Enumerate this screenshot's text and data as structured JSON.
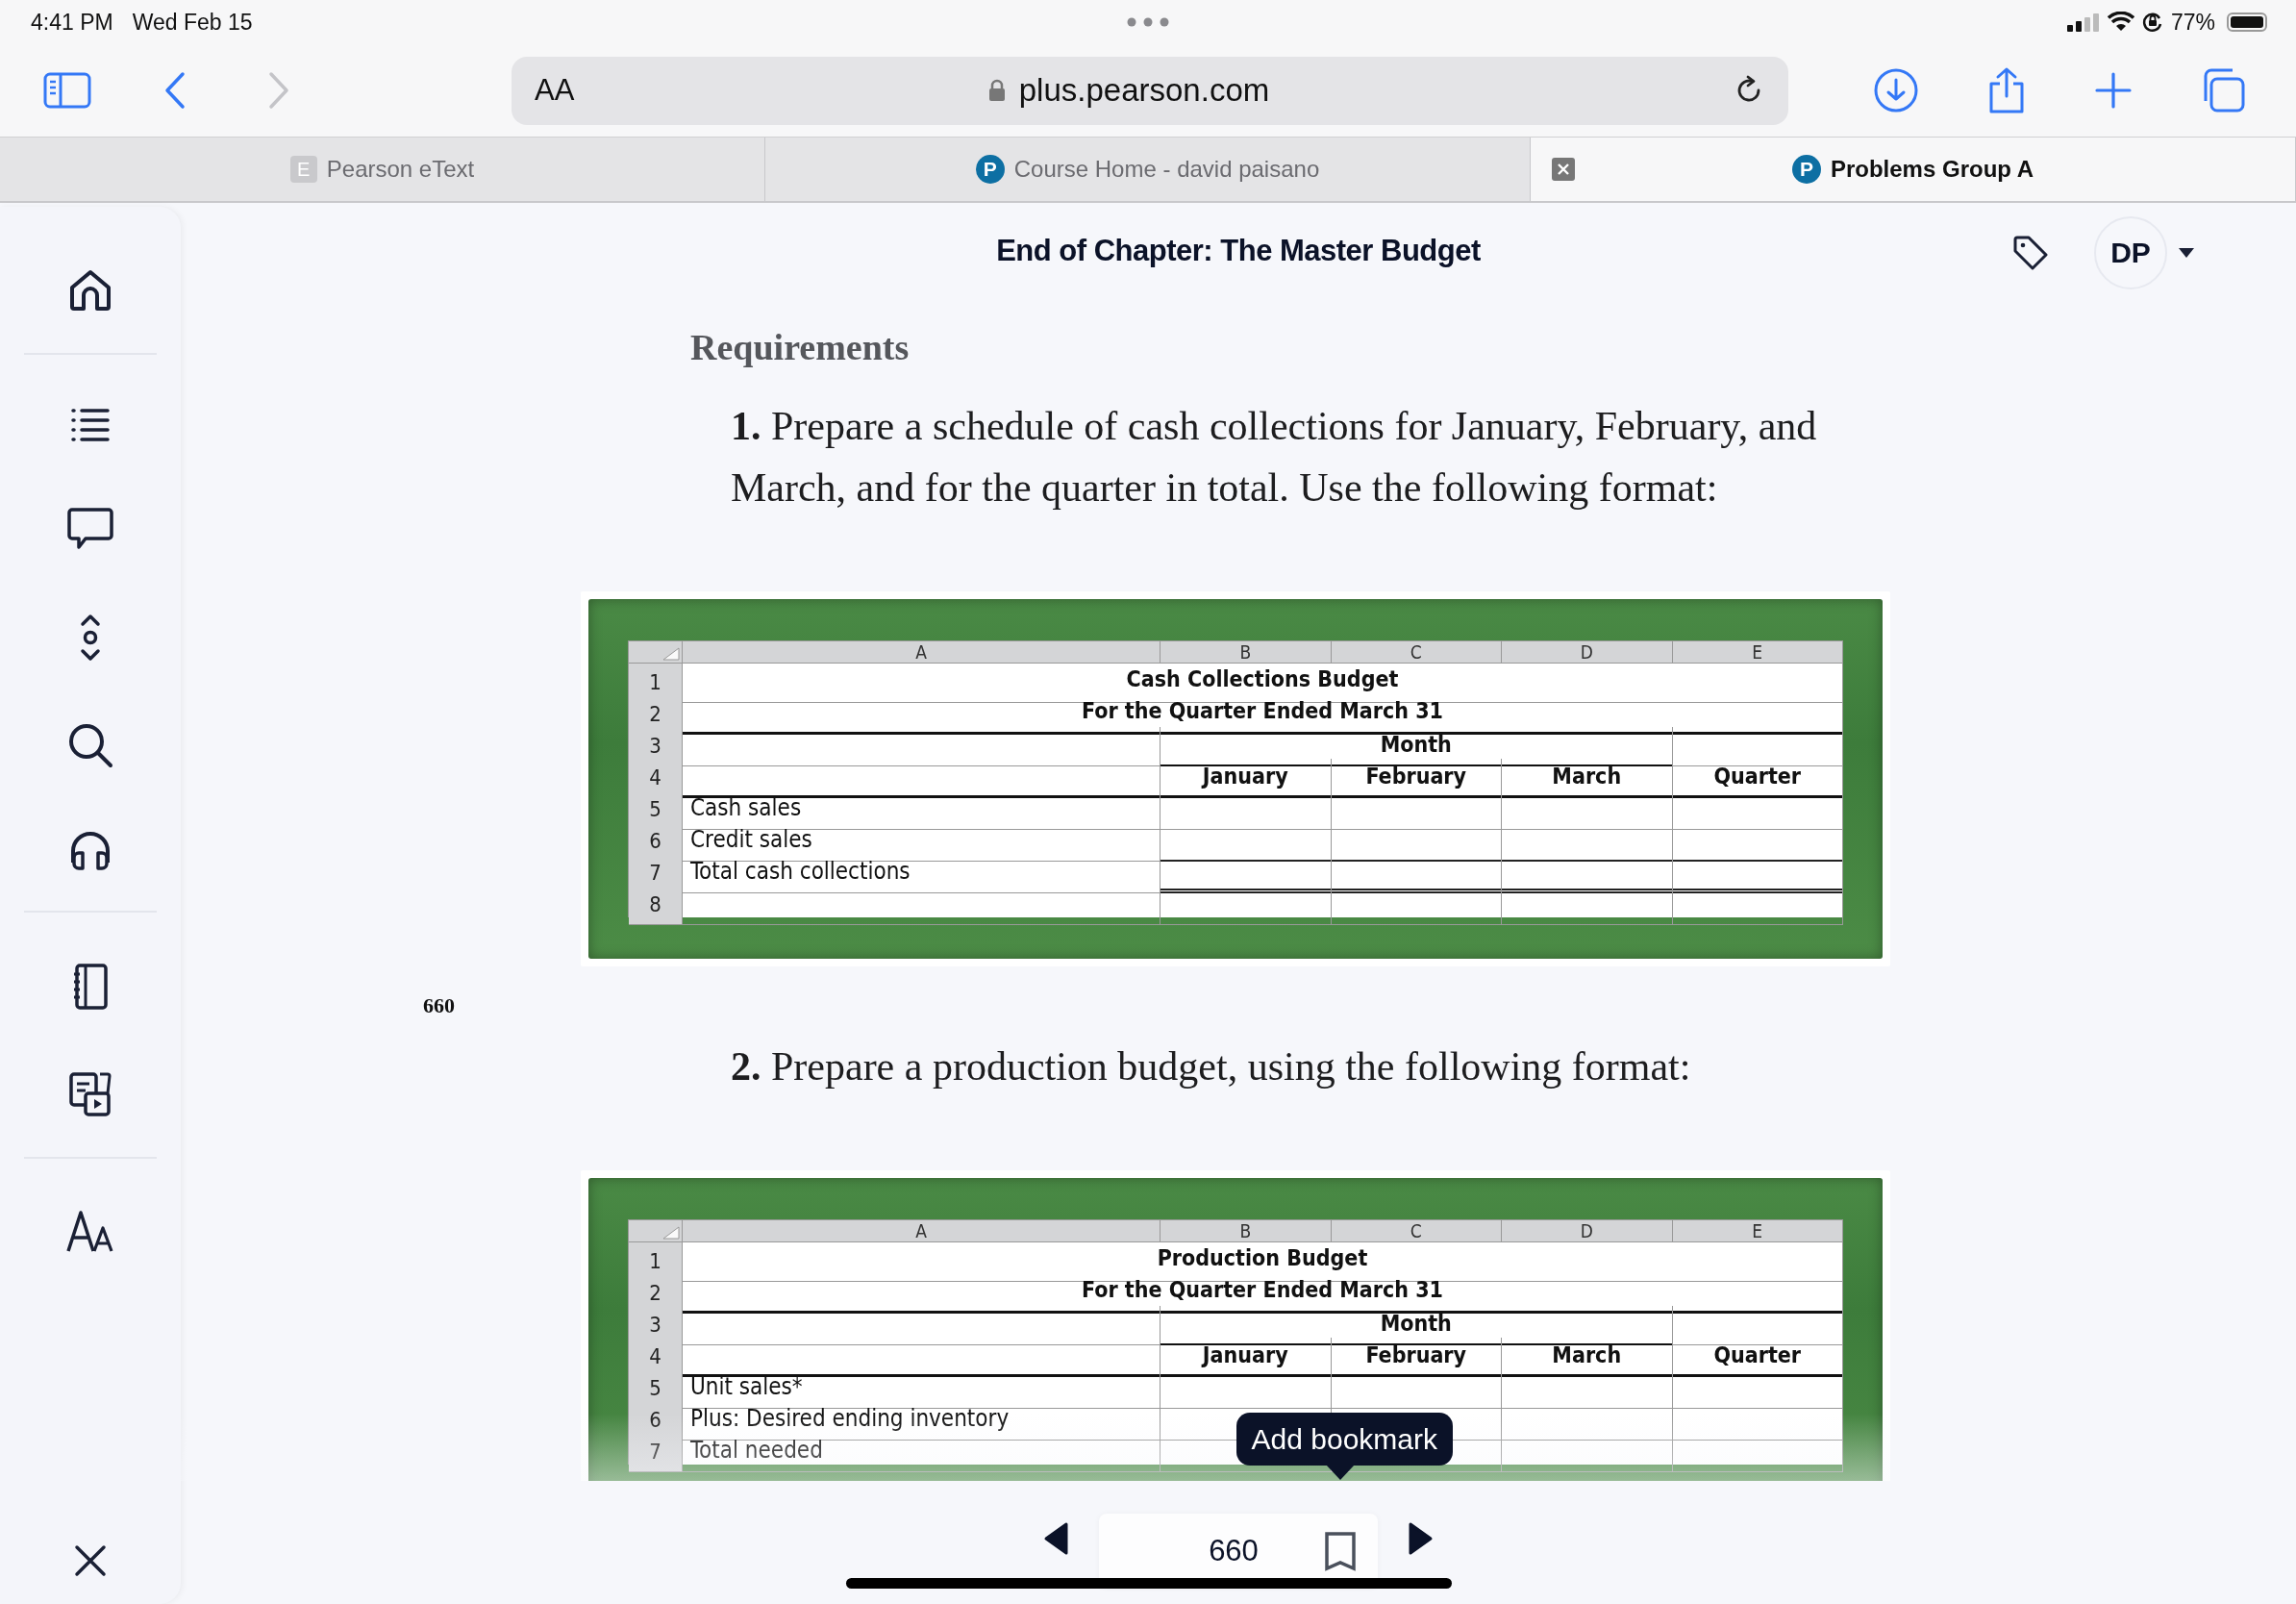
{
  "status_bar": {
    "time": "4:41 PM",
    "date": "Wed Feb 15",
    "battery": "77%"
  },
  "browser": {
    "text_size": "AA",
    "url": "plus.pearson.com",
    "back_enabled": true,
    "forward_enabled": false
  },
  "tabs": [
    {
      "label": "Pearson eText",
      "badge": "E",
      "kind": "letter-square",
      "selected": false,
      "closable": false
    },
    {
      "label": "Course Home - david paisano",
      "badge": "P",
      "kind": "logo",
      "selected": false,
      "closable": false
    },
    {
      "label": "Problems Group A",
      "badge": "P",
      "kind": "logo",
      "selected": true,
      "closable": true
    }
  ],
  "header": {
    "title": "End of Chapter: The Master Budget",
    "avatar": "DP"
  },
  "section_title": "Requirements",
  "page_label": "660",
  "requirements": [
    {
      "number": "1.",
      "text": "Prepare a schedule of cash collections for January, February, and March, and for the quarter in total. Use the following format:",
      "sheet": {
        "columns": [
          "A",
          "B",
          "C",
          "D",
          "E"
        ],
        "title": "Cash Collections Budget",
        "subtitle": "For the Quarter Ended March 31",
        "group_header": "Month",
        "periods": [
          "January",
          "February",
          "March",
          "Quarter"
        ],
        "row_numbers": [
          "1",
          "2",
          "3",
          "4",
          "5",
          "6",
          "7",
          "8"
        ],
        "line_items": [
          {
            "label": "Cash sales",
            "kind": "plain"
          },
          {
            "label": "Credit sales",
            "kind": "subtotal"
          },
          {
            "label": "Total cash collections",
            "kind": "total"
          }
        ]
      }
    },
    {
      "number": "2.",
      "text": "Prepare a production budget, using the following format:",
      "sheet": {
        "columns": [
          "A",
          "B",
          "C",
          "D",
          "E"
        ],
        "title": "Production Budget",
        "subtitle": "For the Quarter Ended March 31",
        "group_header": "Month",
        "periods": [
          "January",
          "February",
          "March",
          "Quarter"
        ],
        "row_numbers": [
          "1",
          "2",
          "3",
          "4",
          "5",
          "6",
          "7"
        ],
        "line_items": [
          {
            "label": "Unit sales*",
            "kind": "plain"
          },
          {
            "label": "Plus: Desired ending inventory",
            "kind": "plain"
          },
          {
            "label": "Total needed",
            "kind": "plain"
          }
        ]
      }
    }
  ],
  "pager": {
    "page": "660",
    "tooltip": "Add bookmark"
  }
}
